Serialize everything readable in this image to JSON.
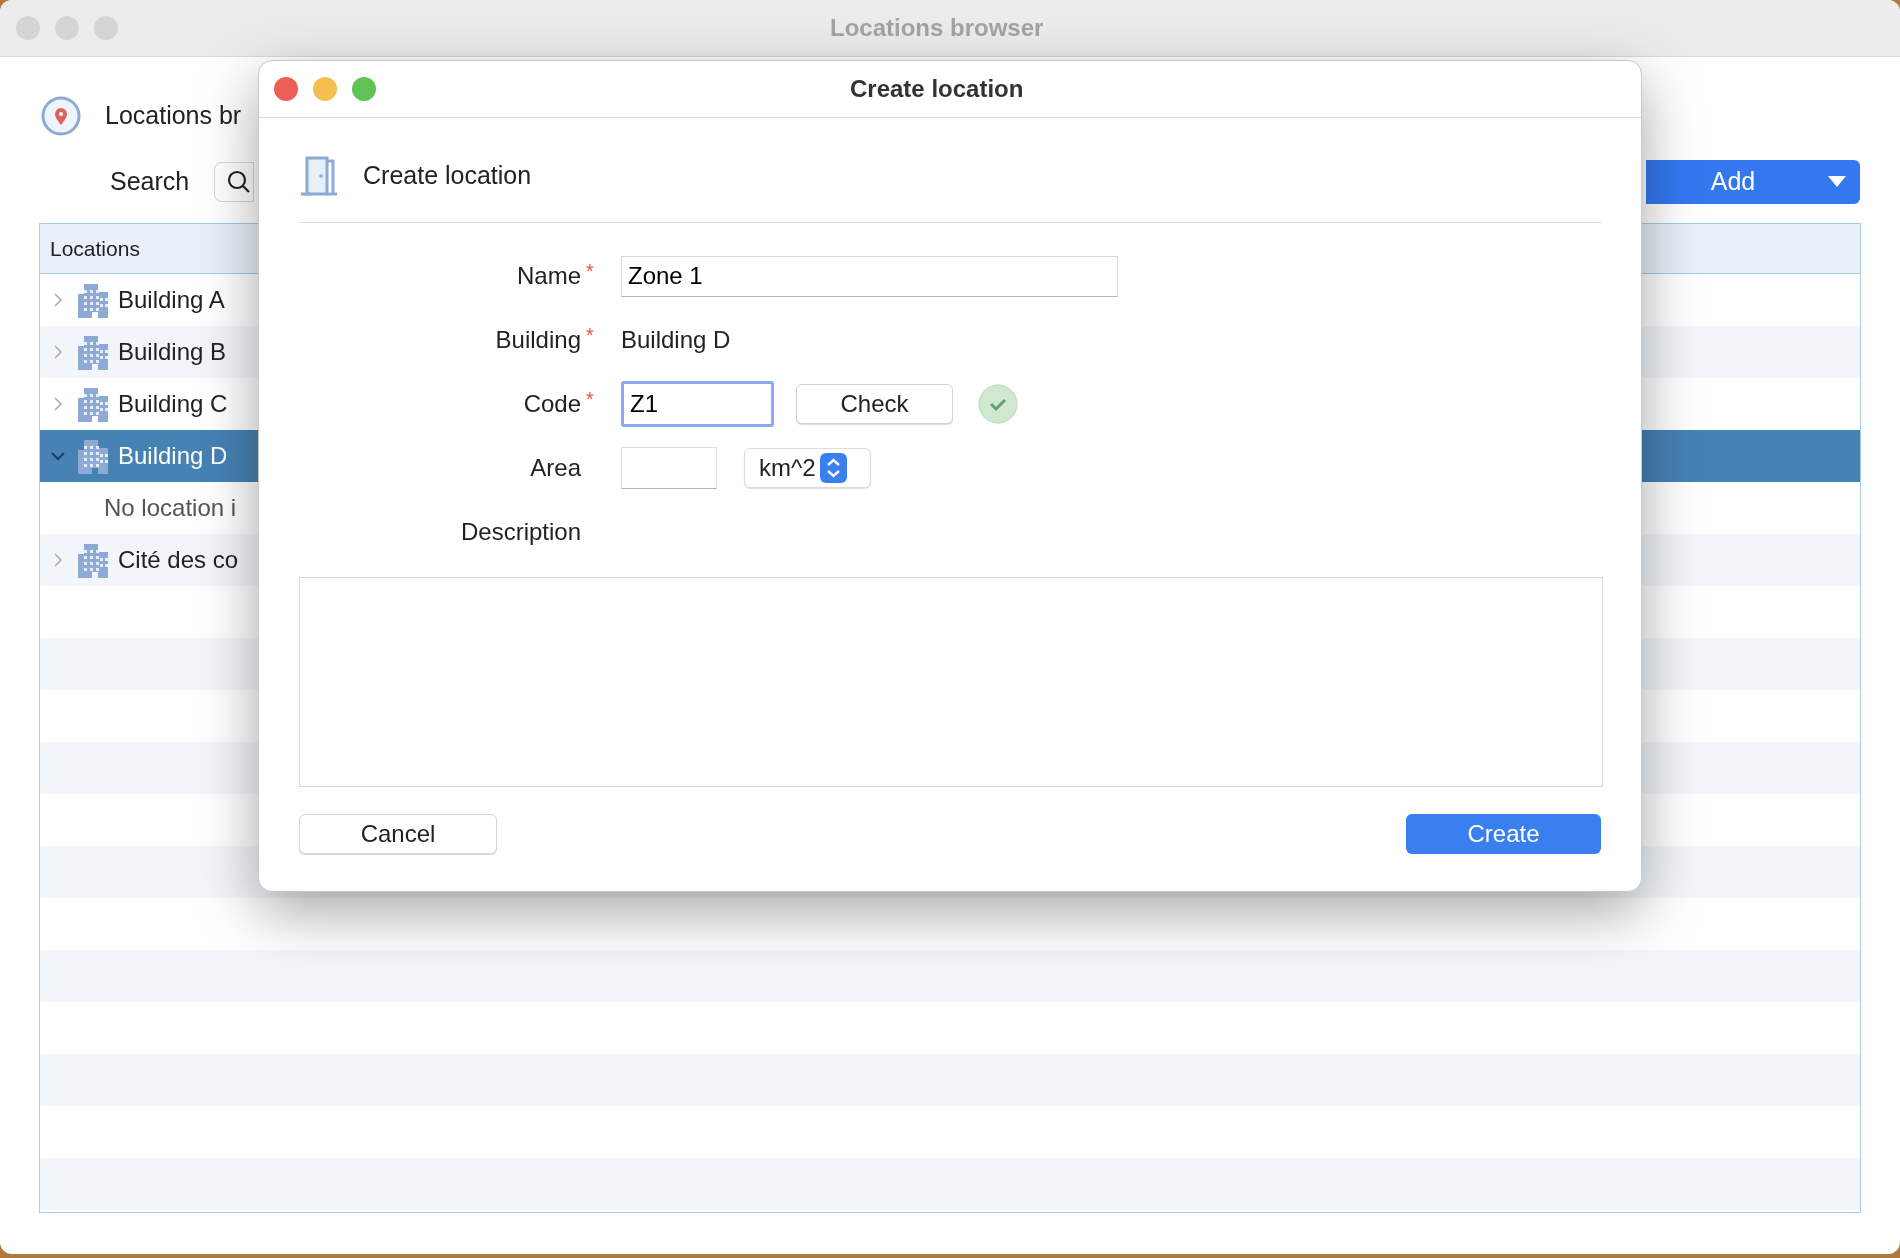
{
  "window": {
    "title": "Locations browser"
  },
  "header": {
    "title": "Locations br"
  },
  "search": {
    "label": "Search"
  },
  "add_button": {
    "label": "Add"
  },
  "tree": {
    "column": "Locations",
    "items": [
      {
        "kind": "building",
        "label": "Building A",
        "expanded": false,
        "selected": false
      },
      {
        "kind": "building",
        "label": "Building B",
        "expanded": false,
        "selected": false
      },
      {
        "kind": "building",
        "label": "Building C",
        "expanded": false,
        "selected": false
      },
      {
        "kind": "building",
        "label": "Building D",
        "expanded": true,
        "selected": true,
        "children": [
          {
            "kind": "placeholder",
            "label": "No location i"
          }
        ]
      },
      {
        "kind": "building",
        "label": "Cité des co",
        "expanded": false,
        "selected": false
      }
    ]
  },
  "dialog": {
    "title": "Create location",
    "heading": "Create location",
    "fields": [
      {
        "kind": "text",
        "label": "Name",
        "required_mark": "*",
        "value": "Zone 1"
      },
      {
        "kind": "static",
        "label": "Building",
        "required_mark": "*",
        "value": "Building D"
      },
      {
        "kind": "code",
        "label": "Code",
        "required_mark": "*",
        "value": "Z1",
        "focused": true,
        "button": "Check",
        "valid": true
      },
      {
        "kind": "unit",
        "label": "Area",
        "unit": "km^2"
      },
      {
        "kind": "textarea",
        "label": "Description"
      }
    ],
    "cancel": "Cancel",
    "create": "Create"
  }
}
